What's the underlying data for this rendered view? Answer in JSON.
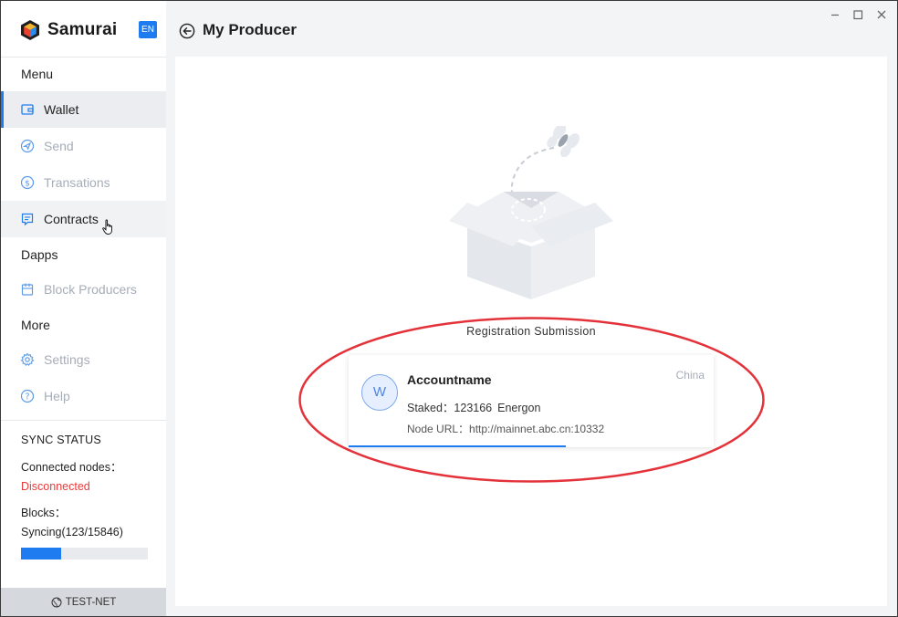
{
  "app": {
    "name": "Samurai",
    "language": "EN",
    "accent_color": "#1f7cf0"
  },
  "menu": {
    "menu_title": "Menu",
    "items": [
      {
        "label": "Wallet",
        "icon": "wallet-icon",
        "state": "active"
      },
      {
        "label": "Send",
        "icon": "send-icon",
        "state": "normal"
      },
      {
        "label": "Transations",
        "icon": "dollar-icon",
        "state": "normal"
      },
      {
        "label": "Contracts",
        "icon": "contract-icon",
        "state": "hover"
      }
    ],
    "dapps_title": "Dapps",
    "dapps_items": [
      {
        "label": "Block Producers",
        "icon": "block-producers-icon"
      }
    ],
    "more_title": "More",
    "more_items": [
      {
        "label": "Settings",
        "icon": "gear-icon"
      },
      {
        "label": "Help",
        "icon": "help-icon"
      }
    ]
  },
  "sync": {
    "title": "SYNC STATUS",
    "nodes_label": "Connected nodes：",
    "nodes_status": "Disconnected",
    "nodes_status_color": "#e83a3a",
    "blocks_label": "Blocks：",
    "blocks_value": "Syncing(123/15846)",
    "progress_fraction": 0.32
  },
  "network": {
    "label": "TEST-NET"
  },
  "header": {
    "title": "My Producer"
  },
  "main": {
    "section_title": "Registration Submission",
    "producer": {
      "avatar_letter": "W",
      "account_name": "Accountname",
      "region": "China",
      "staked_label": "Staked：123166",
      "staked_unit": "Energon",
      "node_url": "Node URL：http://mainnet.abc.cn:10332"
    }
  }
}
